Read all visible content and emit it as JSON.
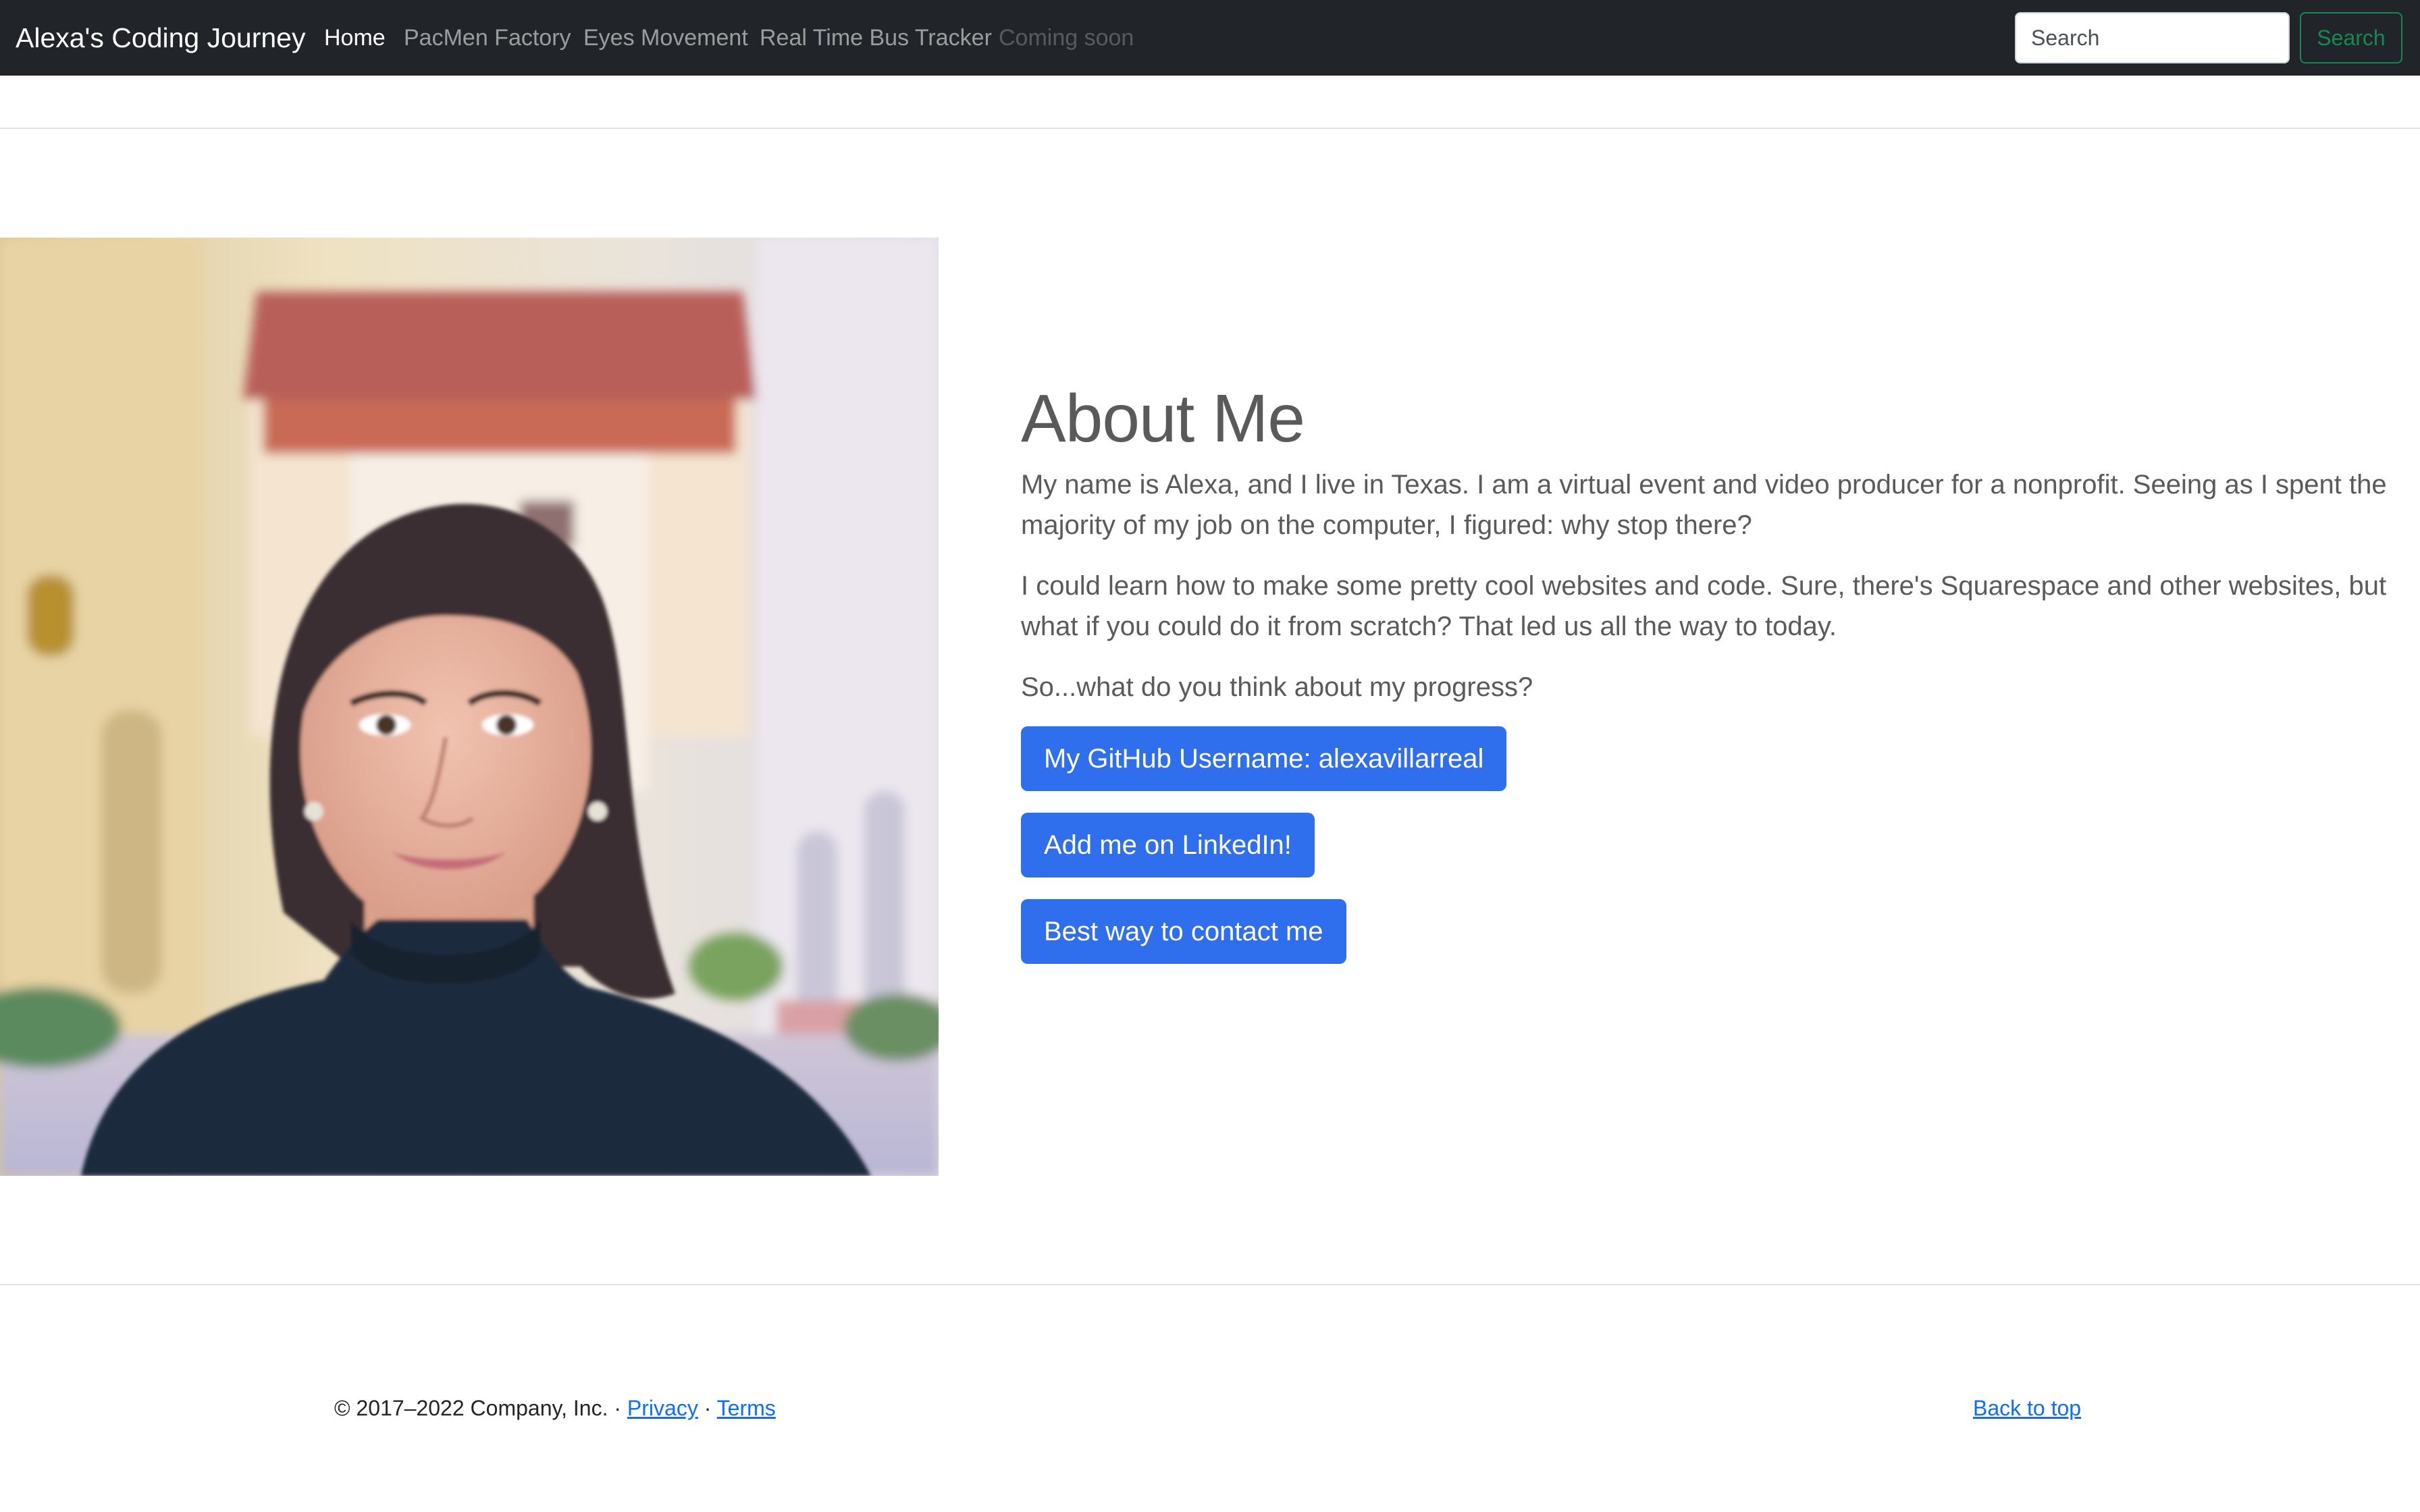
{
  "navbar": {
    "brand": "Alexa's Coding Journey",
    "links": [
      {
        "label": "Home",
        "state": "active"
      },
      {
        "label": "PacMen Factory",
        "state": "normal"
      },
      {
        "label": "Eyes Movement",
        "state": "normal"
      },
      {
        "label": "Real Time Bus Tracker",
        "state": "normal"
      },
      {
        "label": "Coming soon",
        "state": "disabled"
      }
    ],
    "search": {
      "placeholder": "Search",
      "button_label": "Search"
    }
  },
  "feature": {
    "heading": "About Me",
    "paragraphs": [
      "My name is Alexa, and I live in Texas. I am a virtual event and video producer for a nonprofit. Seeing as I spent the majority of my job on the computer, I figured: why stop there?",
      "I could learn how to make some pretty cool websites and code. Sure, there's Squarespace and other websites, but what if you could do it from scratch? That led us all the way to today.",
      "So...what do you think about my progress?"
    ],
    "buttons": [
      "My GitHub Username: alexavillarreal",
      "Add me on LinkedIn!",
      "Best way to contact me"
    ]
  },
  "footer": {
    "copyright": "© 2017–2022 Company, Inc. · ",
    "privacy": "Privacy",
    "separator": " · ",
    "terms": "Terms",
    "back_to_top": "Back to top"
  },
  "colors": {
    "navbar_bg": "#212529",
    "primary": "#2f6fed",
    "success": "#198754",
    "link": "#0d6efd"
  }
}
